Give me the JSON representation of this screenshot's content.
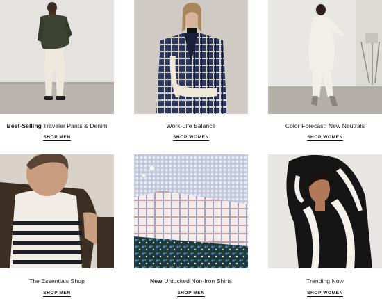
{
  "products": [
    {
      "caption_bold": "Best-Selling",
      "caption_rest": " Traveler Pants & Denim",
      "cta": "SHOP MEN",
      "image": "man-green-hoodie-white-pants"
    },
    {
      "caption_bold": "",
      "caption_rest": "Work-Life Balance",
      "cta": "SHOP WOMEN",
      "image": "woman-plaid-blazer-cream-sweater"
    },
    {
      "caption_bold": "",
      "caption_rest": "Color Forecast: New Neutrals",
      "cta": "SHOP WOMEN",
      "image": "woman-white-suit"
    },
    {
      "caption_bold": "",
      "caption_rest": "The Essentials Shop",
      "cta": "SHOP MEN",
      "image": "man-striped-shirt-jacket"
    },
    {
      "caption_bold": "New",
      "caption_rest": " Untucked Non-Iron Shirts",
      "cta": "SHOP MEN",
      "image": "folded-shirts-stack"
    },
    {
      "caption_bold": "",
      "caption_rest": "Trending Now",
      "cta": "SHOP WOMEN",
      "image": "woman-zebra-print-top"
    }
  ]
}
